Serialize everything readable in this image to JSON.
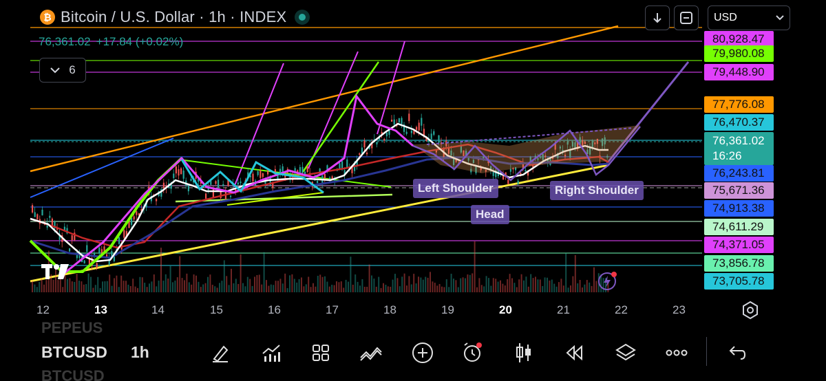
{
  "header": {
    "logo_glyph": "₿",
    "title": "Bitcoin / U.S. Dollar · 1h · INDEX",
    "price": "76,361.02",
    "change": "+17.84 (+0.02%)",
    "indicators_count": "6"
  },
  "top_controls": {
    "currency": "USD"
  },
  "price_axis": [
    {
      "label": "80,928.47",
      "color": "#e040fb"
    },
    {
      "label": "79,980.08",
      "color": "#76ff03"
    },
    {
      "label": "79,448.90",
      "color": "#e040fb"
    },
    {
      "label": "77,776.08",
      "color": "#ff9800"
    },
    {
      "label": "76,470.37",
      "color": "#26c6da"
    },
    {
      "label": "76,361.02",
      "sub": "16:26",
      "color": "#26a69a"
    },
    {
      "label": "76,243.81",
      "color": "#2962ff"
    },
    {
      "label": "75,671.36",
      "color": "#ce93d8"
    },
    {
      "label": "74,913.38",
      "color": "#2962ff"
    },
    {
      "label": "74,611.29",
      "color": "#b9f6ca"
    },
    {
      "label": "74,371.05",
      "color": "#e040fb"
    },
    {
      "label": "73,856.78",
      "color": "#69f0ae"
    },
    {
      "label": "73,705.78",
      "color": "#26c6da"
    }
  ],
  "pattern_labels": {
    "left_shoulder": "Left Shoulder",
    "head": "Head",
    "right_shoulder": "Right Shoulder"
  },
  "time_axis": [
    {
      "label": "12",
      "bold": false
    },
    {
      "label": "13",
      "bold": true
    },
    {
      "label": "14",
      "bold": false
    },
    {
      "label": "15",
      "bold": false
    },
    {
      "label": "16",
      "bold": false
    },
    {
      "label": "17",
      "bold": false
    },
    {
      "label": "18",
      "bold": false
    },
    {
      "label": "19",
      "bold": false
    },
    {
      "label": "20",
      "bold": true
    },
    {
      "label": "21",
      "bold": false
    },
    {
      "label": "22",
      "bold": false
    },
    {
      "label": "23",
      "bold": false
    }
  ],
  "bottom_bar": {
    "ghost_top": "PEPEUS",
    "symbol": "BTCUSD",
    "interval": "1h",
    "ghost_bottom": "BTCUSD"
  },
  "toolbar_icons": [
    "draw-icon",
    "indicators-icon",
    "layouts-icon",
    "cross-ticks-icon",
    "add-icon",
    "alert-icon",
    "candles-icon",
    "replay-icon",
    "layers-icon",
    "more-icon",
    "undo-icon"
  ],
  "colors": {
    "up": "#26a69a",
    "down": "#ef5350",
    "ma_white": "#ffffff",
    "ma_yellow": "#ffeb3b",
    "ma_red": "#b71c1c",
    "ma_blue": "#2962ff",
    "pattern": "#7e57c2"
  }
}
